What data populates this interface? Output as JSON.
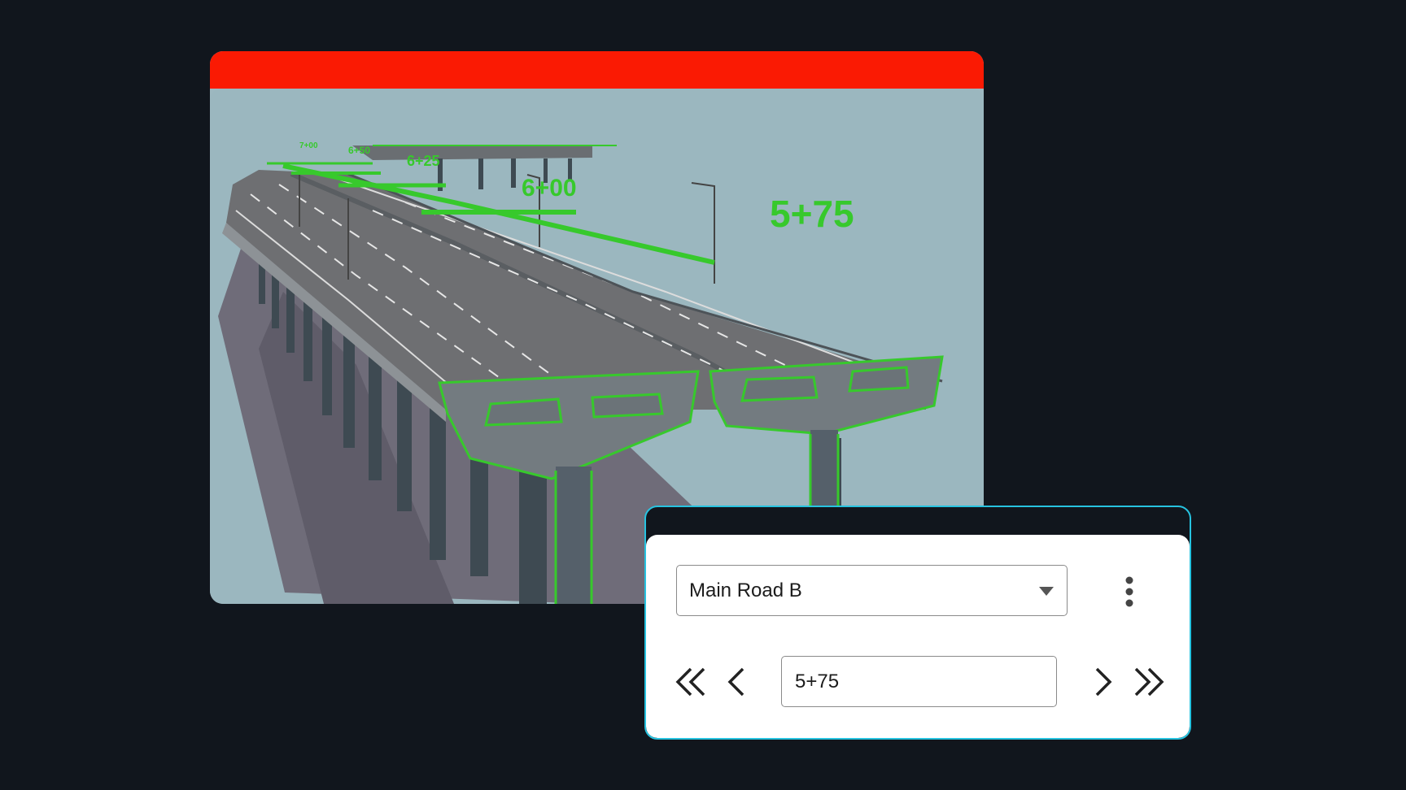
{
  "viewer": {
    "station_labels": [
      "5+75",
      "6+00",
      "6+25",
      "6+50",
      "7+00"
    ]
  },
  "navigator": {
    "route_select": {
      "value": "Main Road B"
    },
    "station_input": {
      "value": "5+75"
    },
    "icons": {
      "dropdown": "caret-down-icon",
      "menu": "more-vertical-icon",
      "first": "double-chevron-left-icon",
      "prev": "chevron-left-icon",
      "next": "chevron-right-icon",
      "last": "double-chevron-right-icon"
    }
  },
  "colors": {
    "background": "#11161d",
    "viewer_header": "#fa1a03",
    "panel_border": "#27c3e0",
    "highlight": "#37c92c",
    "sky": "#9bb7bf"
  }
}
